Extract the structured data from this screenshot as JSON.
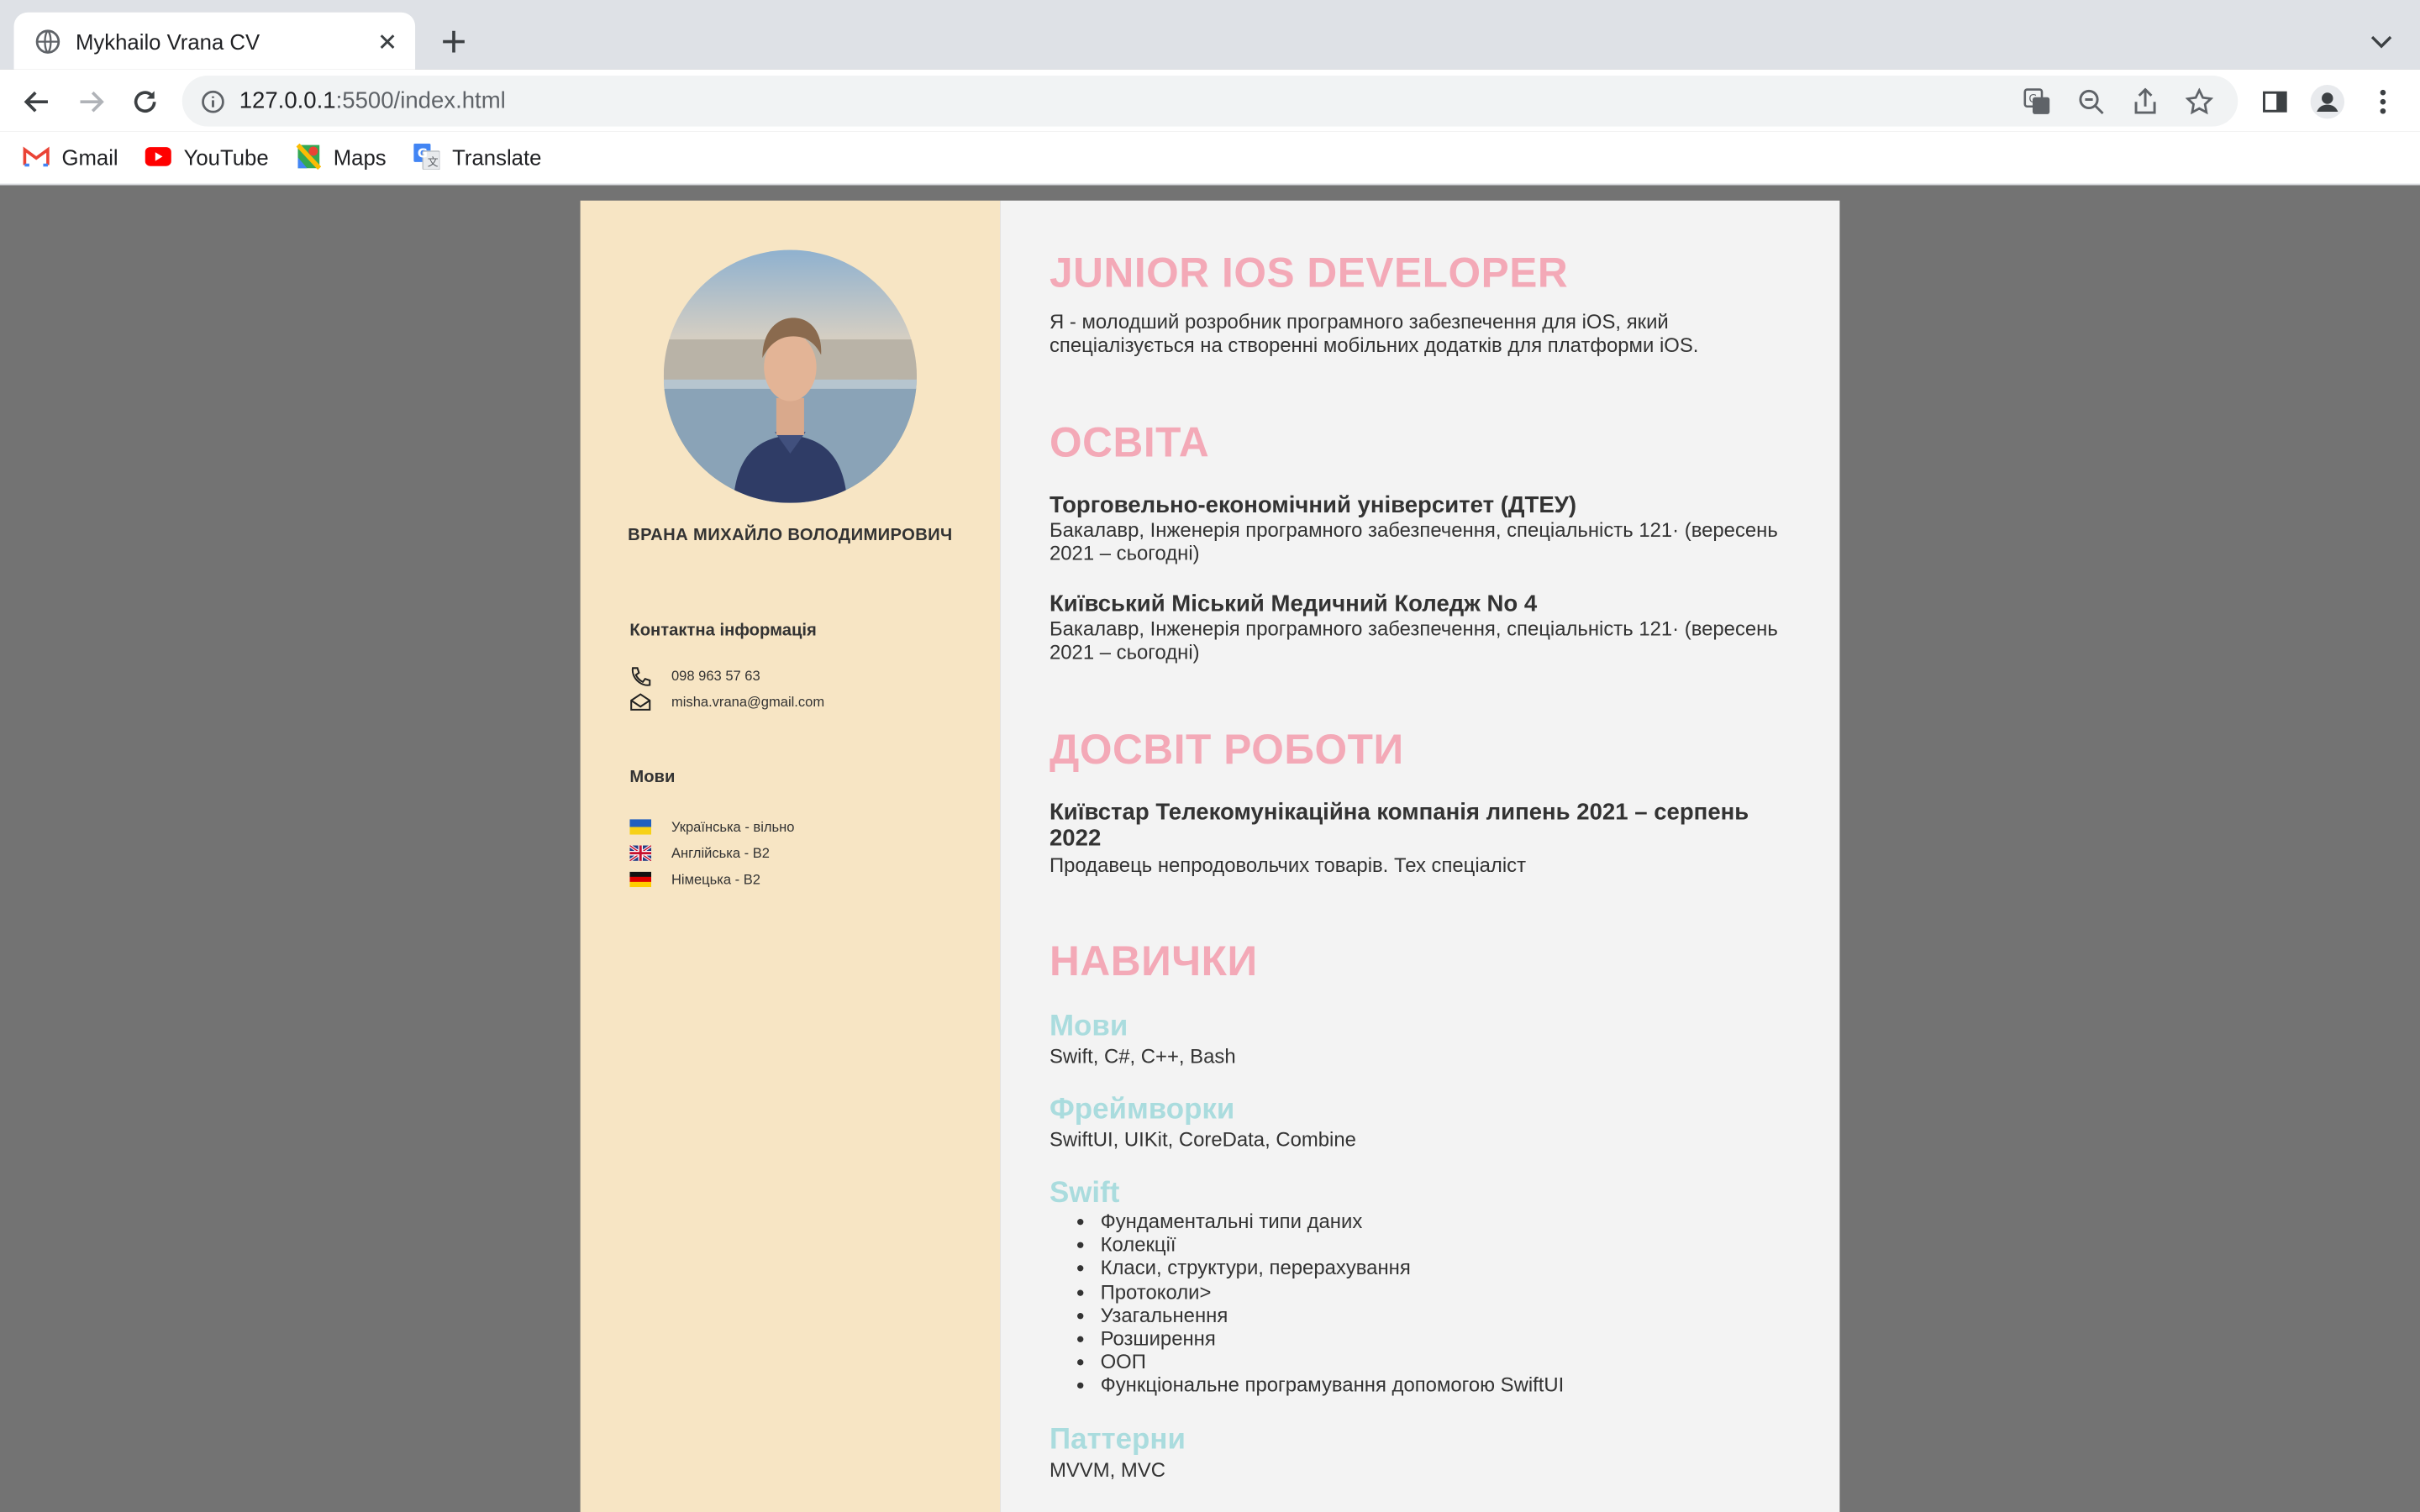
{
  "browser": {
    "tab_title": "Mykhailo Vrana CV",
    "url_host": "127.0.0.1",
    "url_path": ":5500/index.html",
    "bookmarks": [
      "Gmail",
      "YouTube",
      "Maps",
      "Translate"
    ]
  },
  "sidebar": {
    "name": "ВРАНА МИХАЙЛО ВОЛОДИМИРОВИЧ",
    "contact_heading": "Контактна інформація",
    "phone": "098 963 57 63",
    "email": "misha.vrana@gmail.com",
    "languages_heading": "Мови",
    "languages": [
      "Українська - вільно",
      "Англійська - B2",
      "Німецька - B2"
    ]
  },
  "main": {
    "title": "JUNIOR IOS DEVELOPER",
    "intro": "Я - молодший розробник програмного забезпечення для iOS, який спеціалізується на створенні мобільних додатків для платформи iOS.",
    "education_heading": "ОСВІТА",
    "education": [
      {
        "school": "Торговельно-економічний університет (ДТЕУ)",
        "desc": "Бакалавр, Інженерія програмного забезпечення, спеціальність 121· (вересень 2021 – сьогодні)"
      },
      {
        "school": "Київський Міський Медичний Коледж No 4",
        "desc": "Бакалавр, Інженерія програмного забезпечення, спеціальність 121· (вересень 2021 – сьогодні)"
      }
    ],
    "experience_heading": "ДОСВІТ РОБОТИ",
    "experience": {
      "title": "Київстар Телекомунікаційна компанія липень 2021 – серпень 2022",
      "desc": "Продавець непродовольчих товарів. Тех спеціаліст"
    },
    "skills_heading": "НАВИЧКИ",
    "skills": {
      "languages_label": "Мови",
      "languages_value": "Swift, C#, C++, Bash",
      "frameworks_label": "Фреймворки",
      "frameworks_value": "SwiftUI, UIKit, CoreData, Combine",
      "swift_label": "Swift",
      "swift_items": [
        "Фундаментальні типи даних",
        "Колекції",
        "Класи, структури, перерахування",
        "Протоколи>",
        "Узагальнення",
        "Розширення",
        "ООП",
        "Функціональне програмування допомогою SwiftUI"
      ],
      "patterns_label": "Паттерни",
      "patterns_value": "MVVM, MVC"
    }
  },
  "colors": {
    "heading_pink": "#f3a9b7",
    "skill_teal": "#aadcde",
    "sidebar_bg": "#f7e5c4",
    "main_bg": "#f3f3f3"
  }
}
